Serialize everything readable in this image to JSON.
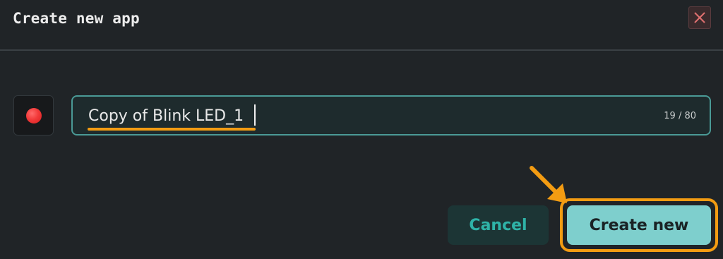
{
  "dialog": {
    "title": "Create new app",
    "close_icon": "close-icon"
  },
  "app_icon": {
    "icon": "red-dot-icon",
    "color": "#f23a3a"
  },
  "name_field": {
    "value": "Copy of Blink LED_1",
    "char_count": "19 / 80"
  },
  "actions": {
    "cancel_label": "Cancel",
    "create_label": "Create new"
  },
  "colors": {
    "accent": "#4a9a96",
    "primary_button": "#7ecfcd",
    "annotation": "#f39c12"
  }
}
